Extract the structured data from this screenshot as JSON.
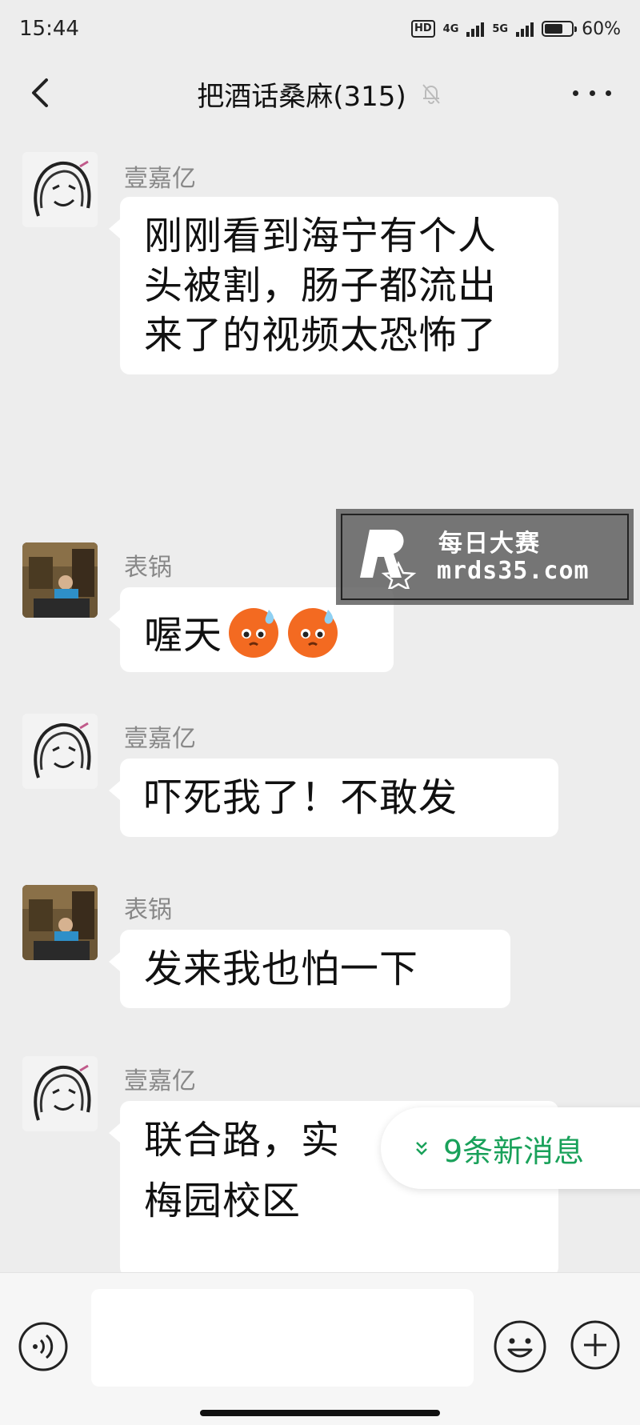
{
  "status": {
    "time": "15:44",
    "hd_label": "HD",
    "net1": "4G",
    "net2": "5G",
    "battery_percent": "60%",
    "battery_level": 0.6
  },
  "header": {
    "title": "把酒话桑麻(315)",
    "muted_icon": "bell-off-icon",
    "back_icon": "chevron-left-icon",
    "more_icon": "more-dots-icon"
  },
  "messages": [
    {
      "sender": "壹嘉亿",
      "text": "刚刚看到海宁有个人头被割，肠子都流出来了的视频太恐怖了"
    },
    {
      "sender": "表锅",
      "text": "喔天",
      "emojis": [
        "sweat-face-emoji",
        "sweat-face-emoji"
      ]
    },
    {
      "sender": "壹嘉亿",
      "text": "吓死我了！不敢发"
    },
    {
      "sender": "表锅",
      "text": "发来我也怕一下"
    },
    {
      "sender": "壹嘉亿",
      "text": "联合路，实",
      "text_line2": "梅园校区"
    }
  ],
  "watermark": {
    "line1": "每日大赛",
    "line2": "mrds35.com"
  },
  "new_messages_pill": {
    "label": "9条新消息"
  },
  "input_bar": {
    "input_value": "",
    "voice_icon": "voice-icon",
    "emoji_icon": "smiley-icon",
    "plus_icon": "plus-circle-icon"
  }
}
